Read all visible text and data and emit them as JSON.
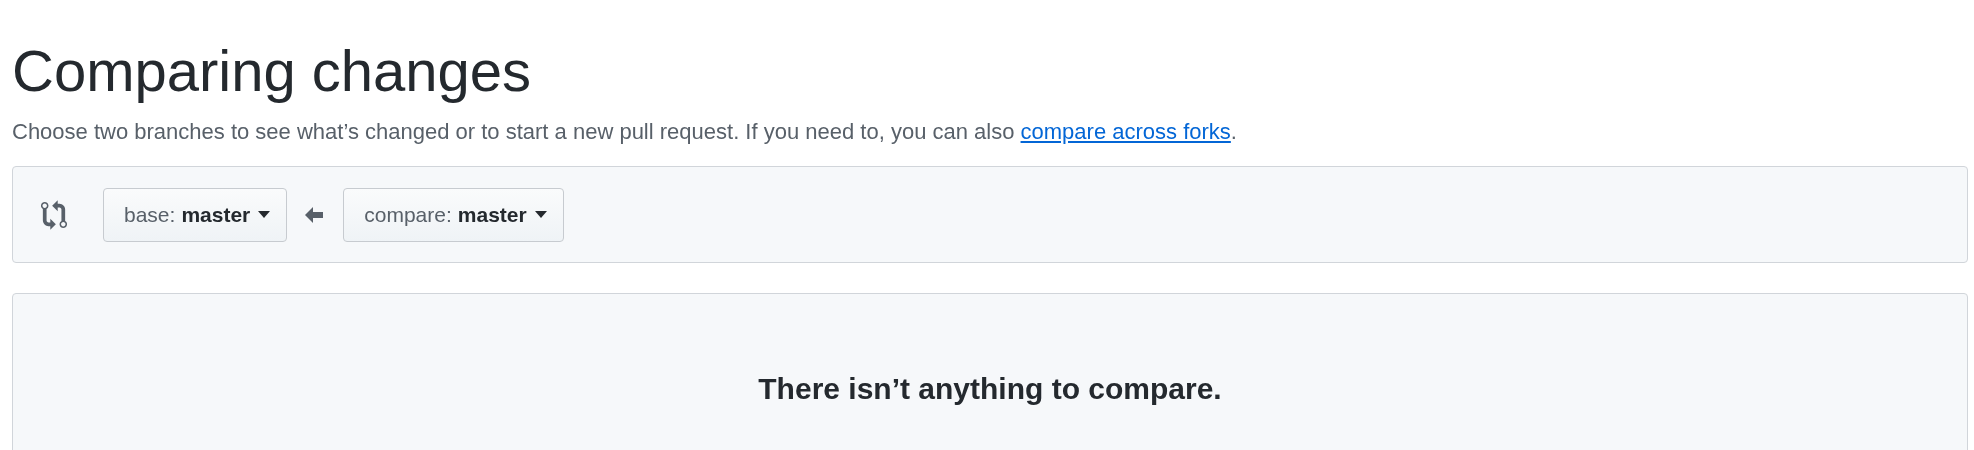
{
  "title": "Comparing changes",
  "description": {
    "text": "Choose two branches to see what’s changed or to start a new pull request. If you need to, you can also ",
    "link": "compare across forks",
    "after": "."
  },
  "range": {
    "base": {
      "label": "base:",
      "branch": "master"
    },
    "compare": {
      "label": "compare:",
      "branch": "master"
    }
  },
  "blankslate": {
    "heading": "There isn’t anything to compare."
  }
}
